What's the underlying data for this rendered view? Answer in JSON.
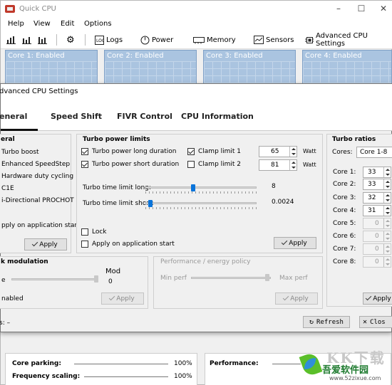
{
  "main_window": {
    "title": "Quick CPU",
    "menu": [
      "Help",
      "View",
      "Edit",
      "Options"
    ],
    "toolbar": {
      "logs": "Logs",
      "power": "Power",
      "memory": "Memory",
      "sensors": "Sensors",
      "advanced": "Advanced CPU Settings"
    },
    "cores": [
      "Core 1: Enabled",
      "Core 2: Enabled",
      "Core 3: Enabled",
      "Core 4: Enabled"
    ],
    "bottom": {
      "core_parking_label": "Core parking:",
      "core_parking_value": "100%",
      "freq_scaling_label": "Frequency scaling:",
      "freq_scaling_value": "100%",
      "performance_label": "Performance:"
    }
  },
  "dialog": {
    "title": "dvanced CPU Settings",
    "tabs": [
      "eneral",
      "Speed Shift",
      "FIVR Control",
      "CPU Information"
    ],
    "general": {
      "title": "eral",
      "options": [
        "Turbo boost",
        "Enhanced SpeedStep",
        "Hardware duty cycling",
        "C1E",
        "i-Directional PROCHOT"
      ],
      "apply_on_start": "pply on application start",
      "apply": "Apply"
    },
    "turbo_power": {
      "title": "Turbo power limits",
      "long_duration": "Turbo power long duration",
      "short_duration": "Turbo power short duration",
      "clamp1": "Clamp limit 1",
      "clamp2": "Clamp limit 2",
      "value1": "65",
      "value2": "81",
      "unit1": "Watt",
      "unit2": "Watt",
      "time_long_label": "Turbo time limit long:",
      "time_long_value": "8",
      "time_short_label": "Turbo time limit short:",
      "time_short_value": "0.0024",
      "lock": "Lock",
      "apply_on_start": "Apply on application start",
      "apply": "Apply"
    },
    "clock_mod": {
      "title": "k modulation",
      "mode_label": "Mod",
      "value": "0",
      "left_short": "e",
      "enabled": "nabled",
      "apply": "Apply"
    },
    "perf_energy": {
      "title": "Performance / energy policy",
      "min": "Min perf",
      "max": "Max perf",
      "apply": "Apply"
    },
    "turbo_ratios": {
      "title": "Turbo ratios",
      "cores_label": "Cores:",
      "cores_value": "Core 1-8",
      "rows": [
        {
          "label": "Core 1:",
          "value": "33"
        },
        {
          "label": "Core 2:",
          "value": "33"
        },
        {
          "label": "Core 3:",
          "value": "32"
        },
        {
          "label": "Core 4:",
          "value": "31"
        },
        {
          "label": "Core 5:",
          "value": "0"
        },
        {
          "label": "Core 6:",
          "value": "0"
        },
        {
          "label": "Core 7:",
          "value": "0"
        },
        {
          "label": "Core 8:",
          "value": "0"
        }
      ],
      "apply": "Apply"
    },
    "status": "s: –",
    "refresh": "Refresh",
    "close": "Clos"
  },
  "watermark": {
    "brand": "吾爱软件园",
    "url": "www.52zixue.com",
    "kk": "KK下载"
  }
}
